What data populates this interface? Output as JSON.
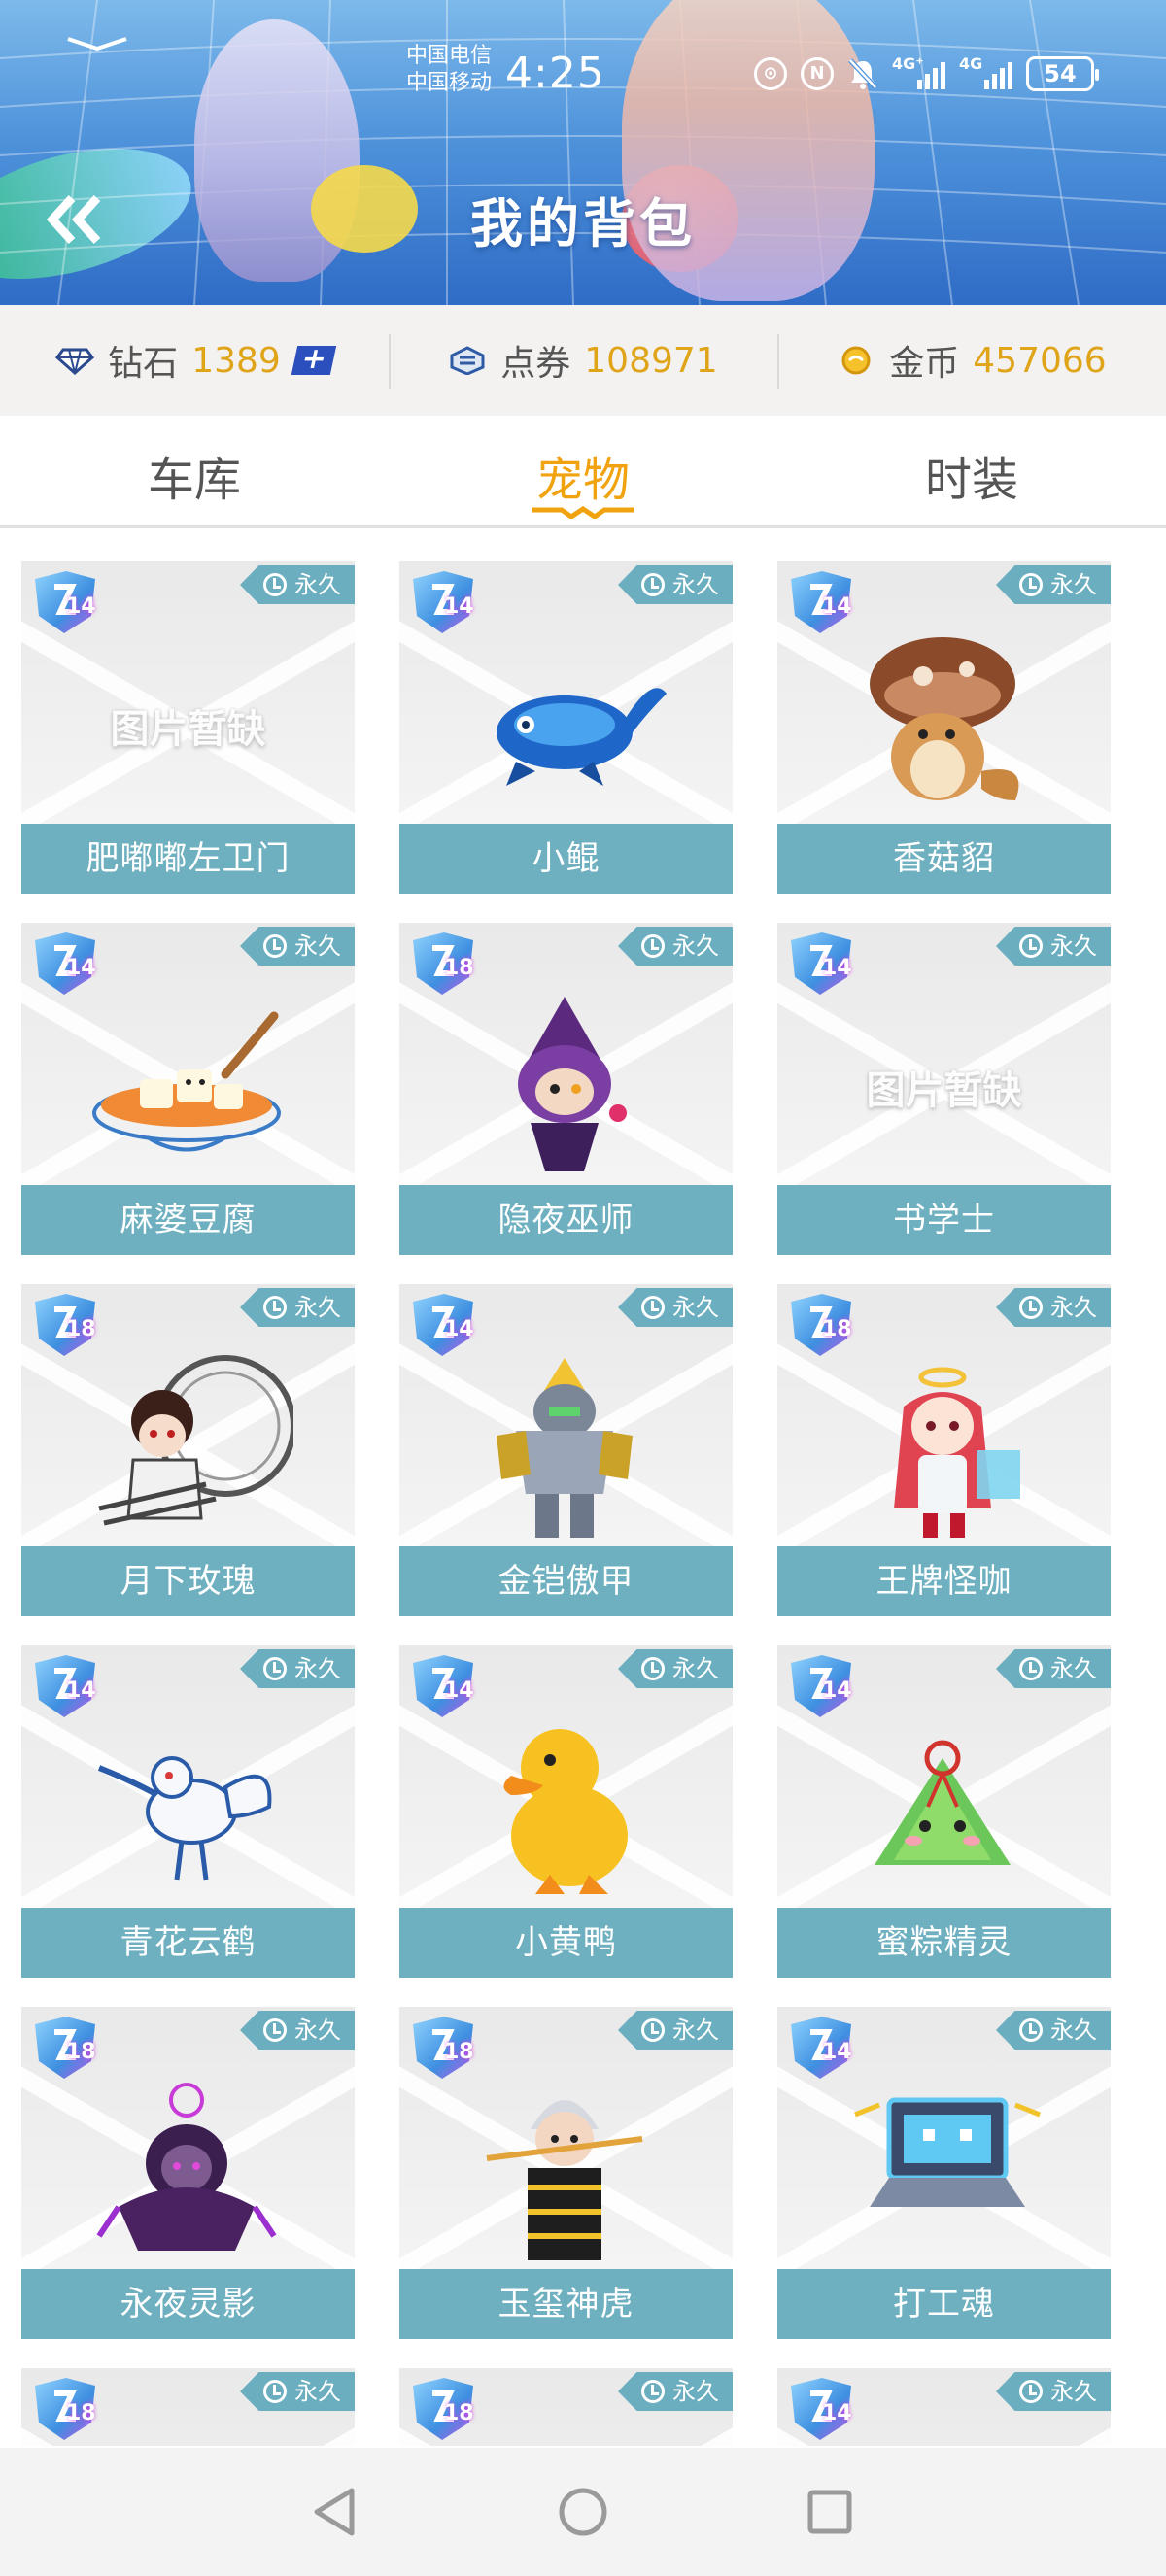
{
  "status_bar": {
    "carrier_1": "中国电信",
    "carrier_2": "中国移动",
    "time": "4:25",
    "network_1": "4G⁺",
    "network_2": "4G",
    "battery": "54"
  },
  "header": {
    "title": "我的背包",
    "back_icon": "double-chevron-left-icon"
  },
  "currencies": [
    {
      "label": "钻石",
      "value": "1389",
      "icon": "diamond-icon",
      "has_add": true
    },
    {
      "label": "点券",
      "value": "108971",
      "icon": "coupon-icon",
      "has_add": false
    },
    {
      "label": "金币",
      "value": "457066",
      "icon": "gold-coin-icon",
      "has_add": false
    }
  ],
  "tabs": [
    {
      "label": "车库",
      "active": false
    },
    {
      "label": "宠物",
      "active": true
    },
    {
      "label": "时装",
      "active": false
    }
  ],
  "pets": [
    {
      "name": "肥嘟嘟左卫门",
      "level": "14",
      "duration": "永久",
      "image_missing": true,
      "missing_text": "图片暂缺"
    },
    {
      "name": "小鲲",
      "level": "14",
      "duration": "永久",
      "image_missing": false
    },
    {
      "name": "香菇貂",
      "level": "14",
      "duration": "永久",
      "image_missing": false
    },
    {
      "name": "麻婆豆腐",
      "level": "14",
      "duration": "永久",
      "image_missing": false
    },
    {
      "name": "隐夜巫师",
      "level": "18",
      "duration": "永久",
      "image_missing": false
    },
    {
      "name": "书学士",
      "level": "14",
      "duration": "永久",
      "image_missing": true,
      "missing_text": "图片暂缺"
    },
    {
      "name": "月下玫瑰",
      "level": "18",
      "duration": "永久",
      "image_missing": false
    },
    {
      "name": "金铠傲甲",
      "level": "14",
      "duration": "永久",
      "image_missing": false
    },
    {
      "name": "王牌怪咖",
      "level": "18",
      "duration": "永久",
      "image_missing": false
    },
    {
      "name": "青花云鹤",
      "level": "14",
      "duration": "永久",
      "image_missing": false
    },
    {
      "name": "小黄鸭",
      "level": "14",
      "duration": "永久",
      "image_missing": false
    },
    {
      "name": "蜜粽精灵",
      "level": "14",
      "duration": "永久",
      "image_missing": false
    },
    {
      "name": "永夜灵影",
      "level": "18",
      "duration": "永久",
      "image_missing": false
    },
    {
      "name": "玉玺神虎",
      "level": "18",
      "duration": "永久",
      "image_missing": false
    },
    {
      "name": "打工魂",
      "level": "14",
      "duration": "永久",
      "image_missing": false
    },
    {
      "name": "",
      "level": "18",
      "duration": "永久",
      "image_missing": false
    },
    {
      "name": "",
      "level": "18",
      "duration": "永久",
      "image_missing": false
    },
    {
      "name": "",
      "level": "14",
      "duration": "永久",
      "image_missing": false
    }
  ],
  "colors": {
    "accent_tab": "#f0a30f",
    "currency_value": "#e0a418",
    "card_label_bg": "#6eb0c0",
    "header_blue": "#4f93db"
  },
  "nav": {
    "back": "triangle-back-icon",
    "home": "circle-home-icon",
    "recent": "square-recents-icon"
  }
}
